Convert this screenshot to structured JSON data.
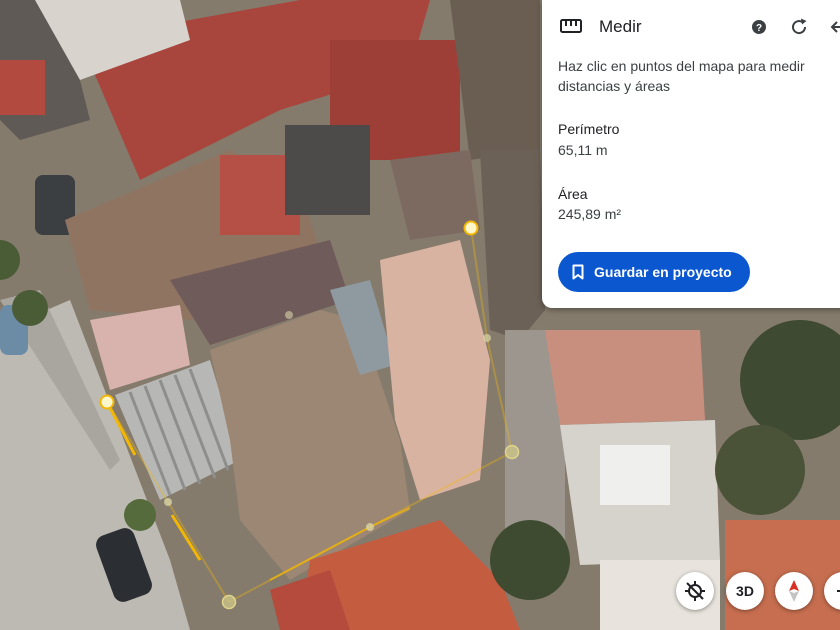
{
  "measure_panel": {
    "title": "Medir",
    "instruction": "Haz clic en puntos del mapa para medir distancias y áreas",
    "perimeter_label": "Perímetro",
    "perimeter_value": "65,11 m",
    "area_label": "Área",
    "area_value": "245,89 m²",
    "save_button": "Guardar en proyecto",
    "accent_color": "#0b57d0",
    "icons": [
      "ruler-icon",
      "help-icon",
      "refresh-icon",
      "back-arrow-icon",
      "bookmark-icon"
    ]
  },
  "map_controls": {
    "tilt_icon": "tilt-icon",
    "view_3d_label": "3D",
    "compass_icon": "compass-icon",
    "zoom_icon": "zoom-icon"
  },
  "measurement": {
    "line_color": "#f2b705",
    "vertex_color": "#fff7cc"
  }
}
